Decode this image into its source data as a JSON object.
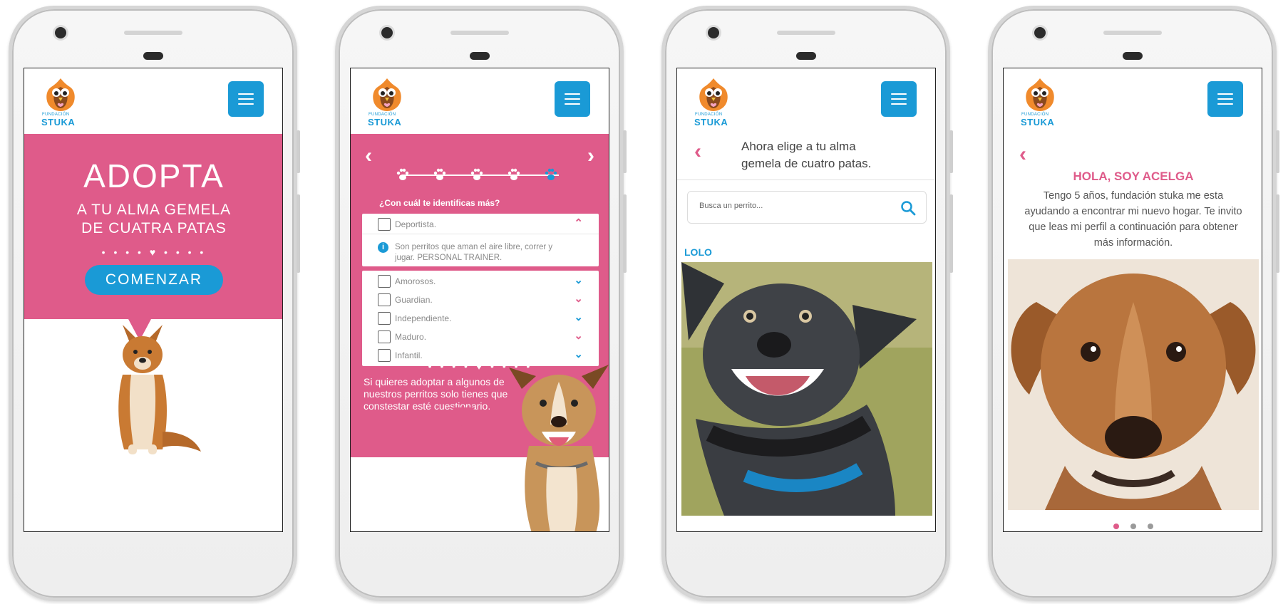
{
  "brand": {
    "logo_small": "FUNDACIÓN",
    "logo_name": "STUKA",
    "pink": "#df5b8a",
    "blue": "#1a9ad6"
  },
  "screen1": {
    "title": "ADOPTA",
    "subtitle_line1": "A TU ALMA GEMELA",
    "subtitle_line2": "DE CUATRA PATAS",
    "divider": "• • • • ♥ • • • •",
    "cta": "COMENZAR"
  },
  "screen2": {
    "prev": "‹",
    "next": "›",
    "question": "¿Con cuál te identificas más?",
    "options": [
      {
        "label": "Deportista.",
        "chevron": "⌃",
        "expanded": true,
        "info": "Son perritos que aman el aire libre, correr y jugar. PERSONAL TRAINER."
      },
      {
        "label": "Amorosos.",
        "chevron": "⌄"
      },
      {
        "label": "Guardian.",
        "chevron": "⌄"
      },
      {
        "label": "Independiente.",
        "chevron": "⌄"
      },
      {
        "label": "Maduro.",
        "chevron": "⌄"
      },
      {
        "label": "Infantil.",
        "chevron": "⌄"
      }
    ],
    "divider": "• • • • ♥ • • • •",
    "footer_text": "Si quieres adoptar a algunos de nuestros perritos solo tienes que constestar esté cuestionario."
  },
  "screen3": {
    "back": "‹",
    "title": "Ahora elige a  tu alma gemela de cuatro patas.",
    "search_placeholder": "Busca un perrito...",
    "dog_name": "LOLO"
  },
  "screen4": {
    "back": "‹",
    "title": "HOLA, SOY ACELGA",
    "body": "Tengo 5 años, fundación stuka me esta ayudando a encontrar mi nuevo hogar. Te invito que leas mi perfil a continuación para obtener más información.",
    "pager": {
      "count": 3,
      "active": 1
    }
  }
}
